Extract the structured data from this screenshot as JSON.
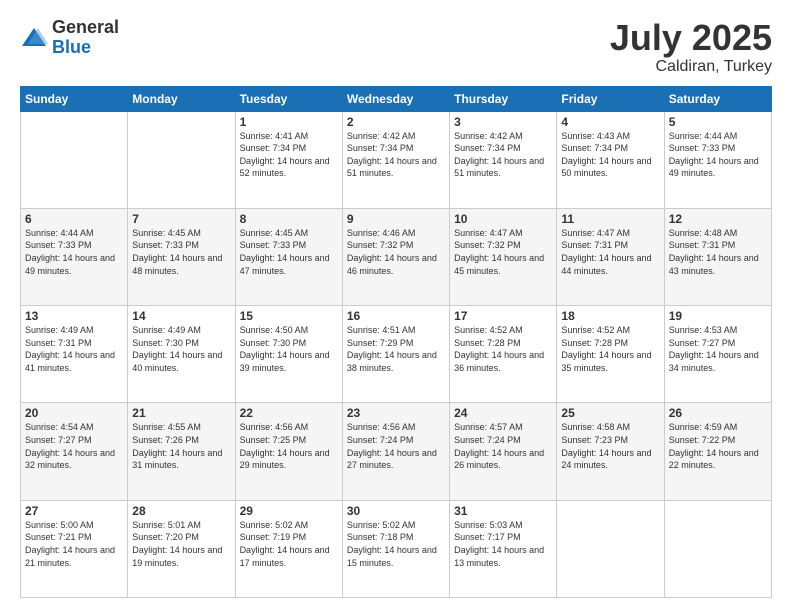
{
  "header": {
    "logo_general": "General",
    "logo_blue": "Blue",
    "month_title": "July 2025",
    "location": "Caldiran, Turkey"
  },
  "weekdays": [
    "Sunday",
    "Monday",
    "Tuesday",
    "Wednesday",
    "Thursday",
    "Friday",
    "Saturday"
  ],
  "weeks": [
    [
      {
        "day": "",
        "info": ""
      },
      {
        "day": "",
        "info": ""
      },
      {
        "day": "1",
        "info": "Sunrise: 4:41 AM\nSunset: 7:34 PM\nDaylight: 14 hours and 52 minutes."
      },
      {
        "day": "2",
        "info": "Sunrise: 4:42 AM\nSunset: 7:34 PM\nDaylight: 14 hours and 51 minutes."
      },
      {
        "day": "3",
        "info": "Sunrise: 4:42 AM\nSunset: 7:34 PM\nDaylight: 14 hours and 51 minutes."
      },
      {
        "day": "4",
        "info": "Sunrise: 4:43 AM\nSunset: 7:34 PM\nDaylight: 14 hours and 50 minutes."
      },
      {
        "day": "5",
        "info": "Sunrise: 4:44 AM\nSunset: 7:33 PM\nDaylight: 14 hours and 49 minutes."
      }
    ],
    [
      {
        "day": "6",
        "info": "Sunrise: 4:44 AM\nSunset: 7:33 PM\nDaylight: 14 hours and 49 minutes."
      },
      {
        "day": "7",
        "info": "Sunrise: 4:45 AM\nSunset: 7:33 PM\nDaylight: 14 hours and 48 minutes."
      },
      {
        "day": "8",
        "info": "Sunrise: 4:45 AM\nSunset: 7:33 PM\nDaylight: 14 hours and 47 minutes."
      },
      {
        "day": "9",
        "info": "Sunrise: 4:46 AM\nSunset: 7:32 PM\nDaylight: 14 hours and 46 minutes."
      },
      {
        "day": "10",
        "info": "Sunrise: 4:47 AM\nSunset: 7:32 PM\nDaylight: 14 hours and 45 minutes."
      },
      {
        "day": "11",
        "info": "Sunrise: 4:47 AM\nSunset: 7:31 PM\nDaylight: 14 hours and 44 minutes."
      },
      {
        "day": "12",
        "info": "Sunrise: 4:48 AM\nSunset: 7:31 PM\nDaylight: 14 hours and 43 minutes."
      }
    ],
    [
      {
        "day": "13",
        "info": "Sunrise: 4:49 AM\nSunset: 7:31 PM\nDaylight: 14 hours and 41 minutes."
      },
      {
        "day": "14",
        "info": "Sunrise: 4:49 AM\nSunset: 7:30 PM\nDaylight: 14 hours and 40 minutes."
      },
      {
        "day": "15",
        "info": "Sunrise: 4:50 AM\nSunset: 7:30 PM\nDaylight: 14 hours and 39 minutes."
      },
      {
        "day": "16",
        "info": "Sunrise: 4:51 AM\nSunset: 7:29 PM\nDaylight: 14 hours and 38 minutes."
      },
      {
        "day": "17",
        "info": "Sunrise: 4:52 AM\nSunset: 7:28 PM\nDaylight: 14 hours and 36 minutes."
      },
      {
        "day": "18",
        "info": "Sunrise: 4:52 AM\nSunset: 7:28 PM\nDaylight: 14 hours and 35 minutes."
      },
      {
        "day": "19",
        "info": "Sunrise: 4:53 AM\nSunset: 7:27 PM\nDaylight: 14 hours and 34 minutes."
      }
    ],
    [
      {
        "day": "20",
        "info": "Sunrise: 4:54 AM\nSunset: 7:27 PM\nDaylight: 14 hours and 32 minutes."
      },
      {
        "day": "21",
        "info": "Sunrise: 4:55 AM\nSunset: 7:26 PM\nDaylight: 14 hours and 31 minutes."
      },
      {
        "day": "22",
        "info": "Sunrise: 4:56 AM\nSunset: 7:25 PM\nDaylight: 14 hours and 29 minutes."
      },
      {
        "day": "23",
        "info": "Sunrise: 4:56 AM\nSunset: 7:24 PM\nDaylight: 14 hours and 27 minutes."
      },
      {
        "day": "24",
        "info": "Sunrise: 4:57 AM\nSunset: 7:24 PM\nDaylight: 14 hours and 26 minutes."
      },
      {
        "day": "25",
        "info": "Sunrise: 4:58 AM\nSunset: 7:23 PM\nDaylight: 14 hours and 24 minutes."
      },
      {
        "day": "26",
        "info": "Sunrise: 4:59 AM\nSunset: 7:22 PM\nDaylight: 14 hours and 22 minutes."
      }
    ],
    [
      {
        "day": "27",
        "info": "Sunrise: 5:00 AM\nSunset: 7:21 PM\nDaylight: 14 hours and 21 minutes."
      },
      {
        "day": "28",
        "info": "Sunrise: 5:01 AM\nSunset: 7:20 PM\nDaylight: 14 hours and 19 minutes."
      },
      {
        "day": "29",
        "info": "Sunrise: 5:02 AM\nSunset: 7:19 PM\nDaylight: 14 hours and 17 minutes."
      },
      {
        "day": "30",
        "info": "Sunrise: 5:02 AM\nSunset: 7:18 PM\nDaylight: 14 hours and 15 minutes."
      },
      {
        "day": "31",
        "info": "Sunrise: 5:03 AM\nSunset: 7:17 PM\nDaylight: 14 hours and 13 minutes."
      },
      {
        "day": "",
        "info": ""
      },
      {
        "day": "",
        "info": ""
      }
    ]
  ]
}
